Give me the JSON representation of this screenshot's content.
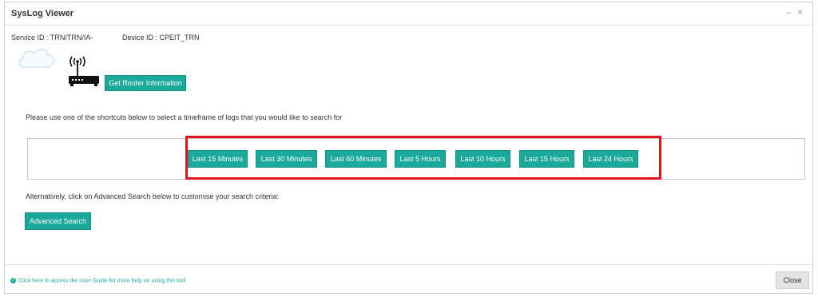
{
  "window": {
    "title": "SysLog Viewer",
    "minimize_glyph": "–",
    "close_glyph": "×"
  },
  "ids": {
    "service_id": "Service ID : TRN/TRN/IA-",
    "device_id": "Device ID : CPEIT_TRN"
  },
  "router": {
    "button_label": "Get Router Information"
  },
  "shortcuts": {
    "instruction": "Please use one of the shortcuts below to select a timeframe of logs that you would like to search for",
    "buttons": [
      "Last 15 Minutes",
      "Last 30 Minutes",
      "Last 60 Minutes",
      "Last 5 Hours",
      "Last 10 Hours",
      "Last 15 Hours",
      "Last 24 Hours"
    ]
  },
  "advanced": {
    "instruction": "Alternatively, click on Advanced Search below to customise your search criteria:",
    "button_label": "Advanced Search"
  },
  "footer": {
    "help_text": "Click here to access the User Guide for more help on using this tool",
    "close_label": "Close"
  },
  "colors": {
    "accent": "#1aa99b",
    "highlight": "#e0141b"
  },
  "icons": [
    "cloud-icon",
    "router-icon",
    "info-icon"
  ]
}
